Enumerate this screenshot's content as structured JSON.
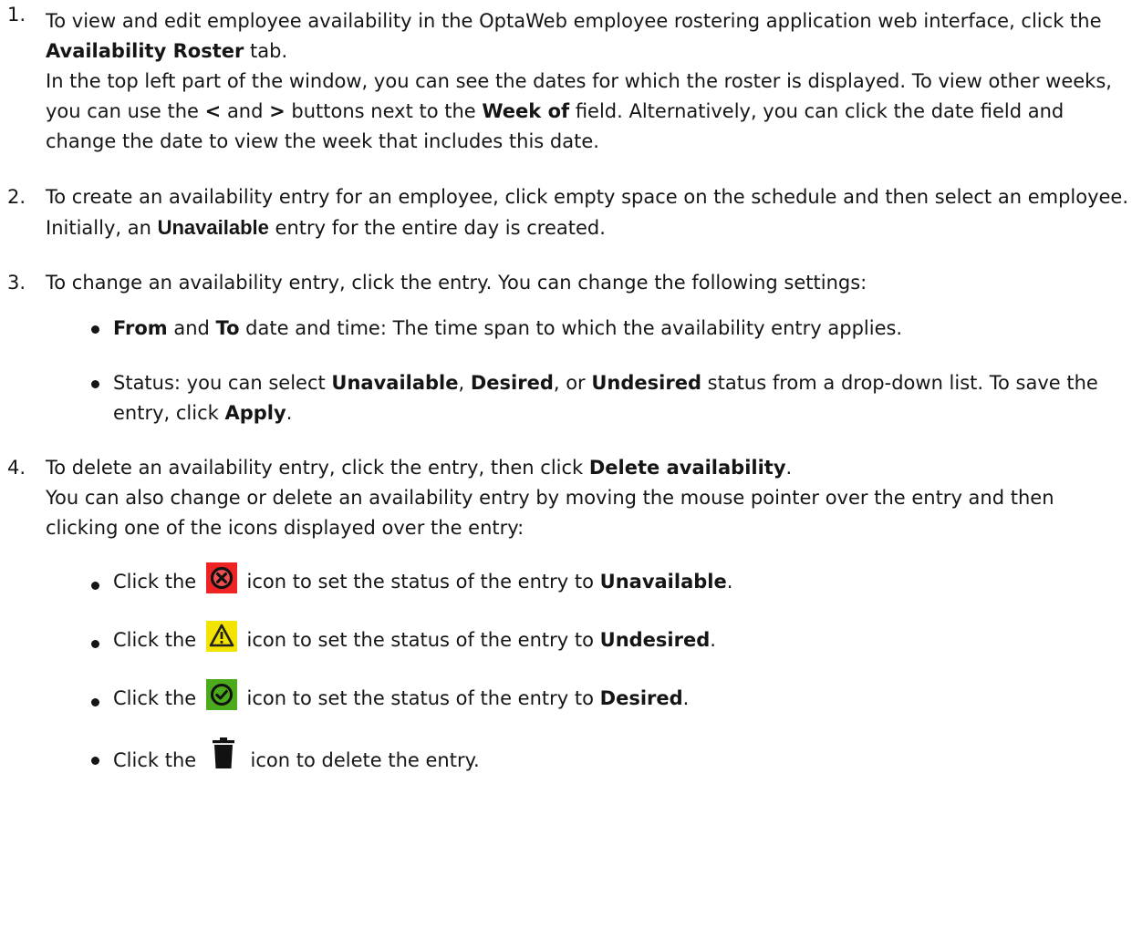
{
  "steps": [
    {
      "number": "1.",
      "line1_pre": "To view and edit employee availability in the OptaWeb employee rostering application web interface, click the ",
      "line1_bold": "Availability Roster",
      "line1_post": " tab.",
      "line2_pre": "In the top left part of the window, you can see the dates for which the roster is displayed. To view other weeks, you can use the ",
      "lt": "<",
      "mid": " and ",
      "gt": ">",
      "line2_mid": " buttons next to the ",
      "line2_bold": "Week of",
      "line2_post": " field. Alternatively, you can click the date field and change the date to view the week that includes this date."
    },
    {
      "number": "2.",
      "pre": "To create an availability entry for an employee, click empty space on the schedule and then select an employee. Initially, an ",
      "bold": "Unavailable",
      "post": " entry for the entire day is created."
    },
    {
      "number": "3.",
      "text": "To change an availability entry, click the entry. You can change the following settings:",
      "bullets": [
        {
          "b1": "From",
          "and": " and ",
          "b2": "To",
          "rest": " date and time: The time span to which the availability entry applies."
        },
        {
          "pre": "Status: you can select ",
          "b1": "Unavailable",
          "sep1": ", ",
          "b2": "Desired",
          "sep2": ", or ",
          "b3": "Undesired",
          "mid": " status from a drop-down list. To save the entry, click ",
          "b4": "Apply",
          "post": "."
        }
      ]
    },
    {
      "number": "4.",
      "line1_pre": "To delete an availability entry, click the entry, then click ",
      "line1_bold": "Delete availability",
      "line1_post": ".",
      "line2": "You can also change or delete an availability entry by moving the mouse pointer over the entry and then clicking one of the icons displayed over the entry:",
      "bullets": [
        {
          "pre": "Click the ",
          "icon": "unavailable-icon",
          "mid": " icon to set the status of the entry to ",
          "bold": "Unavailable",
          "post": "."
        },
        {
          "pre": "Click the ",
          "icon": "undesired-icon",
          "mid": " icon to set the status of the entry to ",
          "bold": "Undesired",
          "post": "."
        },
        {
          "pre": "Click the ",
          "icon": "desired-icon",
          "mid": " icon to set the status of the entry to ",
          "bold": "Desired",
          "post": "."
        },
        {
          "pre": "Click the ",
          "icon": "trash-icon",
          "mid": " icon to delete the entry.",
          "bold": "",
          "post": ""
        }
      ]
    }
  ],
  "colors": {
    "text": "#151515",
    "unavailable_bg": "#ee2424",
    "undesired_bg": "#f2e300",
    "desired_bg": "#4cab1c"
  }
}
